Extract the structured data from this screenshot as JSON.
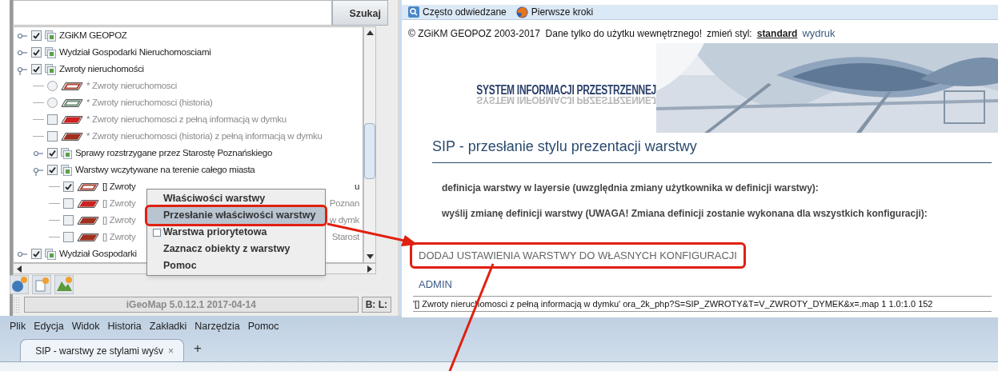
{
  "search_panel": {
    "button": "Szukaj"
  },
  "layer_tree": [
    {
      "kind": "group",
      "label": "ZGiKM GEOPOZ",
      "checked": true,
      "expanded": false
    },
    {
      "kind": "group",
      "label": "Wydział Gospodarki Nieruchomosciami",
      "checked": true,
      "expanded": false
    },
    {
      "kind": "group",
      "label": "Zwroty nieruchomości",
      "checked": true,
      "expanded": true,
      "children": [
        {
          "kind": "layer",
          "radio": true,
          "label": "* Zwroty nieruchomosci",
          "checked": false,
          "dimmed": true,
          "color": "#b04a3a",
          "filled": false
        },
        {
          "kind": "layer",
          "radio": true,
          "label": "* Zwroty nieruchomosci (historia)",
          "checked": false,
          "dimmed": true,
          "color": "#6f8f78",
          "filled": false
        },
        {
          "kind": "layer",
          "radio": false,
          "label": "* Zwroty nieruchomosci z pełną informacją w dymku",
          "checked": false,
          "dimmed": true,
          "color": "#cc2222",
          "filled": true
        },
        {
          "kind": "layer",
          "radio": false,
          "label": "* Zwroty nieruchomosci (historia) z pełną informacją w dymku",
          "checked": false,
          "dimmed": true,
          "color": "#a0301f",
          "filled": true
        },
        {
          "kind": "group",
          "label": "Sprawy rozstrzygane przez Starostę Poznańskiego",
          "checked": true,
          "expanded": false
        },
        {
          "kind": "group",
          "label": "Warstwy wczytywane na terenie całego miasta",
          "checked": true,
          "expanded": true,
          "children": [
            {
              "kind": "layer",
              "radio": false,
              "label": "[] Zwroty",
              "tail": "u",
              "checked": true,
              "dimmed": false,
              "color": "#b04a3a",
              "filled": false
            },
            {
              "kind": "layer",
              "radio": false,
              "label": "[] Zwroty",
              "tail": "Poznan",
              "checked": false,
              "dimmed": true,
              "color": "#cc2222",
              "filled": true
            },
            {
              "kind": "layer",
              "radio": false,
              "label": "[] Zwroty",
              "tail": "w dymk",
              "checked": false,
              "dimmed": true,
              "color": "#a0301f",
              "filled": true
            },
            {
              "kind": "layer",
              "radio": false,
              "label": "[] Zwroty",
              "tail": "Starost",
              "checked": false,
              "dimmed": true,
              "color": "#a0301f",
              "filled": true
            }
          ]
        }
      ]
    },
    {
      "kind": "group",
      "label": "Wydział Gospodarki",
      "checked": true,
      "expanded": false
    }
  ],
  "context_menu": [
    {
      "kind": "item",
      "label": "Właściwości warstwy",
      "selected": false
    },
    {
      "kind": "item",
      "label": "Przesłanie właściwości warstwy",
      "selected": true
    },
    {
      "kind": "checkbox",
      "label": "Warstwa priorytetowa",
      "checked": false,
      "selected": false
    },
    {
      "kind": "item",
      "label": "Zaznacz obiekty z warstwy",
      "selected": false
    },
    {
      "kind": "item",
      "label": "Pomoc",
      "selected": false
    }
  ],
  "status_bar": {
    "version": "iGeoMap 5.0.12.1 2017-04-14",
    "coords": "B: L:"
  },
  "bookmarks": [
    {
      "kind": "search",
      "label": "Często odwiedzane"
    },
    {
      "kind": "browser",
      "label": "Pierwsze kroki"
    }
  ],
  "page": {
    "copyright": "© ZGiKM GEOPOZ 2003-2017  Dane tylko do użytku wewnętrznego!",
    "style_label": "zmień styl:",
    "style_links": [
      {
        "label": "standard",
        "selected": true
      },
      {
        "label": "wydruk",
        "selected": false
      }
    ],
    "logo": "SYSTEM INFORMACJI PRZESTRZENNEJ",
    "logo_reflection": "SYSTEM INFORMACJI PRZESTRZENNEJ",
    "heading": "SIP - przesłanie stylu prezentacji warstwy",
    "paragraphs": [
      "definicja warstwy w layersie (uwzględnia zmiany użytkownika w definicji warstwy):",
      "wyślij zmianę definicji warstwy (UWAGA! Zmiana definicji zostanie wykonana dla wszystkich konfiguracji):"
    ],
    "links": [
      {
        "label": "DODAJ USTAWIENIA WARSTWY DO WŁASNYCH KONFIGURACJI",
        "highlighted": true
      },
      {
        "label": "ADMIN",
        "highlighted": false
      }
    ],
    "footer": "'[] Zwroty nieruchomosci z pełną informacją w dymku' ora_2k_php?S=SIP_ZWROTY&T=V_ZWROTY_DYMEK&x=.map 1 1.0:1.0 152"
  },
  "menu_bar": [
    "Plik",
    "Edycja",
    "Widok",
    "Historia",
    "Zakładki",
    "Narzędzia",
    "Pomoc"
  ],
  "tabs": [
    {
      "label": "SIP - warstwy ze stylami wyśv",
      "selected": true,
      "close": "×"
    }
  ],
  "new_tab": "+"
}
